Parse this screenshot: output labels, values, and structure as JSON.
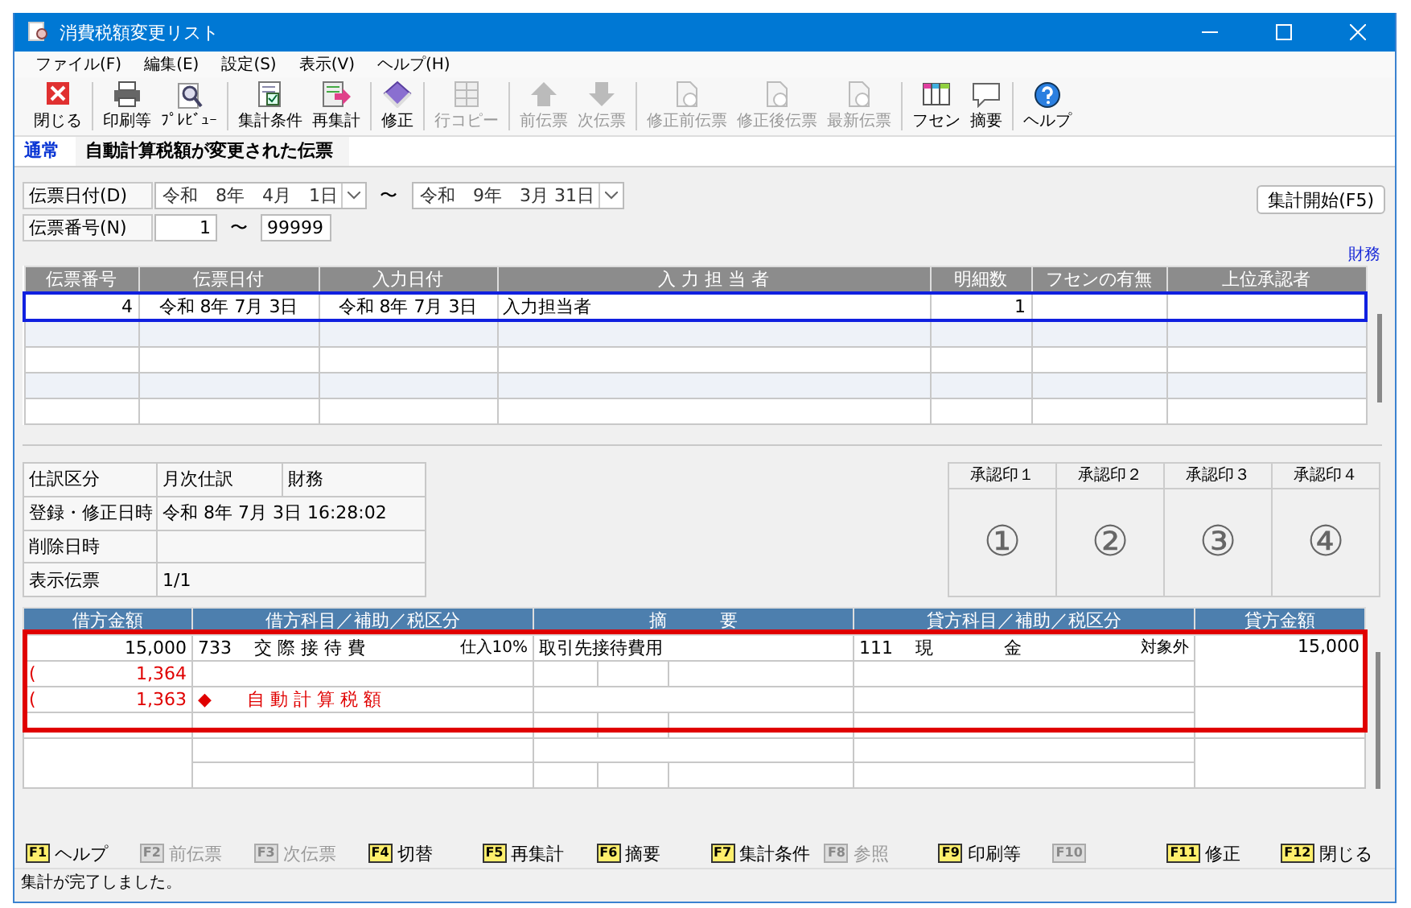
{
  "window": {
    "title": "消費税額変更リスト"
  },
  "menu": [
    {
      "label": "ファイル(F)"
    },
    {
      "label": "編集(E)"
    },
    {
      "label": "設定(S)"
    },
    {
      "label": "表示(V)"
    },
    {
      "label": "ヘルプ(H)"
    }
  ],
  "toolbar": [
    {
      "items": [
        {
          "label": "閉じる",
          "kind": "close",
          "disabled": false
        }
      ]
    },
    {
      "items": [
        {
          "label": "印刷等",
          "kind": "print",
          "disabled": false
        },
        {
          "label": "ﾌﾟﾚﾋﾞｭｰ",
          "kind": "preview",
          "disabled": false
        }
      ]
    },
    {
      "items": [
        {
          "label": "集計条件",
          "kind": "filter",
          "disabled": false
        },
        {
          "label": "再集計",
          "kind": "refresh",
          "disabled": false
        }
      ]
    },
    {
      "items": [
        {
          "label": "修正",
          "kind": "edit",
          "disabled": false
        }
      ]
    },
    {
      "items": [
        {
          "label": "行コピー",
          "kind": "copy",
          "disabled": true
        }
      ]
    },
    {
      "items": [
        {
          "label": "前伝票",
          "kind": "up",
          "disabled": true
        },
        {
          "label": "次伝票",
          "kind": "down",
          "disabled": true
        }
      ]
    },
    {
      "items": [
        {
          "label": "修正前伝票",
          "kind": "doc",
          "disabled": true
        },
        {
          "label": "修正後伝票",
          "kind": "doc",
          "disabled": true
        },
        {
          "label": "最新伝票",
          "kind": "doc",
          "disabled": true
        }
      ]
    },
    {
      "items": [
        {
          "label": "フセン",
          "kind": "note",
          "disabled": false
        },
        {
          "label": "摘要",
          "kind": "memo",
          "disabled": false
        }
      ]
    },
    {
      "items": [
        {
          "label": "ヘルプ",
          "kind": "help",
          "disabled": false
        }
      ]
    }
  ],
  "tabs": [
    {
      "label": "通常",
      "selected": true
    },
    {
      "label": "自動計算税額が変更された伝票",
      "selected": false
    }
  ],
  "filters": {
    "date_label": "伝票日付(D)",
    "date_from": "令和　8年　4月　1日",
    "date_sep": "〜",
    "date_to": "令和　9年　3月 31日",
    "number_label": "伝票番号(N)",
    "number_from": "1",
    "number_sep": "〜",
    "number_to": "99999"
  },
  "start_button": "集計開始(F5)",
  "dept_label": "財務",
  "vouchers": {
    "columns": [
      "伝票番号",
      "伝票日付",
      "入力日付",
      "入 力 担 当 者",
      "明細数",
      "フセンの有無",
      "上位承認者"
    ],
    "rows": [
      {
        "cells": [
          "4",
          "令和 8年 7月 3日",
          "令和 8年 7月 3日",
          "入力担当者",
          "1"
        ],
        "selected": true
      }
    ]
  },
  "info": [
    {
      "label": "仕訳区分",
      "values": [
        "月次仕訳",
        "財務"
      ]
    },
    {
      "label": "登録・修正日時",
      "values": [
        "令和 8年 7月 3日 16:28:02"
      ]
    },
    {
      "label": "削除日時"
    },
    {
      "label": "表示伝票",
      "values": [
        "1/1"
      ]
    }
  ],
  "stamps": [
    {
      "label": "承認印１",
      "mark": "①"
    },
    {
      "label": "承認印２",
      "mark": "②"
    },
    {
      "label": "承認印３",
      "mark": "③"
    },
    {
      "label": "承認印４",
      "mark": "④"
    }
  ],
  "journal": {
    "columns": [
      "借方金額",
      "借方科目／補助／税区分",
      "摘　　　要",
      "貸方科目／補助／税区分",
      "貸方金額"
    ],
    "rows": [
      {
        "kind": "entry",
        "debit_amount": "15,000",
        "debit_code": "733",
        "debit_account": "交 際 接 待 費",
        "debit_tax": "仕入10%",
        "memo": "取引先接待費用",
        "credit_code": "111",
        "credit_account": "現　　　　金",
        "credit_tax": "対象外",
        "credit_amount": "15,000",
        "tax_mark": "(",
        "tax_amount": "1,364"
      },
      {
        "kind": "auto_tax",
        "tax_mark": "(",
        "debit_amount": "1,363",
        "debit_account": "◆　　自 動 計 算 税 額"
      }
    ]
  },
  "function_keys": [
    {
      "key": "F1",
      "label": "ヘルプ",
      "disabled": false
    },
    {
      "key": "F2",
      "label": "前伝票",
      "disabled": true
    },
    {
      "key": "F3",
      "label": "次伝票",
      "disabled": true
    },
    {
      "key": "F4",
      "label": "切替",
      "disabled": false
    },
    {
      "key": "F5",
      "label": "再集計",
      "disabled": false
    },
    {
      "key": "F6",
      "label": "摘要",
      "disabled": false
    },
    {
      "key": "F7",
      "label": "集計条件",
      "disabled": false
    },
    {
      "key": "F8",
      "label": "参照",
      "disabled": true
    },
    {
      "key": "F9",
      "label": "印刷等",
      "disabled": false
    },
    {
      "key": "F10",
      "disabled": true
    },
    {
      "key": "F11",
      "label": "修正",
      "disabled": false
    },
    {
      "key": "F12",
      "label": "閉じる",
      "disabled": false
    }
  ],
  "status_bar": "集計が完了しました。"
}
